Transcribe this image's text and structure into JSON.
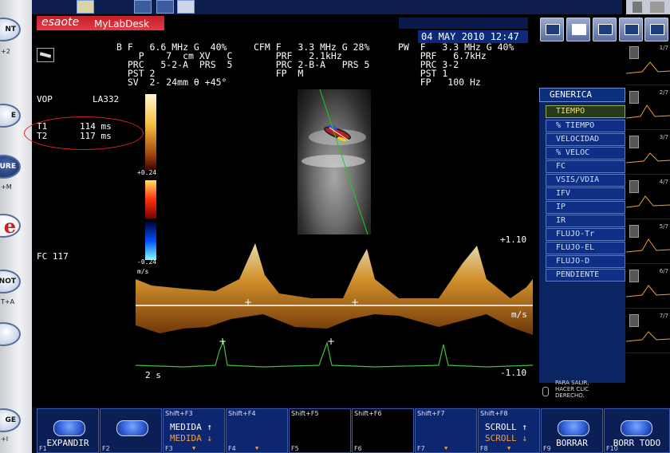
{
  "left_strip": {
    "buttons": [
      {
        "label": "NT",
        "sub": "+2"
      },
      {
        "label": "E",
        "sub": ""
      },
      {
        "label": "SURE",
        "sub": "+M"
      },
      {
        "label": "e",
        "sub": ""
      },
      {
        "label": "NOT",
        "sub": "T+A"
      },
      {
        "label": "",
        "sub": ""
      },
      {
        "label": "GE",
        "sub": "+I"
      }
    ]
  },
  "brand": {
    "logo": "esaote",
    "app": "MyLabDesk"
  },
  "datetime": "04 MAY 2010 12:47",
  "params": {
    "b_col": [
      "B F   6.6 MHz G  40%",
      "    P    7  cm XV   C",
      "  PRC   5-2-A  PRS  5",
      "  PST 2",
      "  SV  2- 24mm θ +45°"
    ],
    "cfm_col": [
      "CFM F   3.3 MHz G 28%",
      "    PRF   2.1kHz",
      "    PRC 2-B-A   PRS 5",
      "    FP  M"
    ],
    "pw_col": [
      "PW  F   3.3 MHz G 40%",
      "    PRF   6.7kHz",
      "    PRC 3-2",
      "    PST 1",
      "    FP   100 Hz"
    ]
  },
  "measurements": {
    "vop": "VOP",
    "probe": "LA332",
    "t1_label": "T1",
    "t1_value": "114 ms",
    "t2_label": "T2",
    "t2_value": "117 ms",
    "fc": "FC 117"
  },
  "colorbar": {
    "top": "+0.24",
    "bottom": "-0.24",
    "unit": "m/s"
  },
  "doppler": {
    "scale_top": "+1.10",
    "scale_bottom": "-1.10",
    "unit": "m/s",
    "time": "2 s"
  },
  "menu": {
    "header": "GENERICA",
    "items": [
      "TIEMPO",
      "% TIEMPO",
      "VELOCIDAD",
      "% VELOC",
      "FC",
      "VSIS/VDIA",
      "IFV",
      "IP",
      "IR",
      "FLUJO-Tr",
      "FLUJO-EL",
      "FLUJO-D",
      "PENDIENTE"
    ],
    "active": "TIEMPO",
    "exit_note": "PARA SALIR,\nHACER CLIC\nDERECHO."
  },
  "thumbs": [
    "1/7",
    "2/7",
    "3/7",
    "4/7",
    "5/7",
    "6/7",
    "7/7"
  ],
  "fkeys": [
    {
      "fnum": "F1",
      "label": "EXPANDIR"
    },
    {
      "fnum": "F2",
      "label": ""
    },
    {
      "fnum": "F3",
      "shift": "Shift+F3",
      "line1": "MEDIDA ↑",
      "line2": "MEDIDA ↓"
    },
    {
      "fnum": "F4",
      "shift": "Shift+F4",
      "line1": "",
      "line2": ""
    },
    {
      "fnum": "F5",
      "shift": "Shift+F5",
      "line1": "",
      "line2": ""
    },
    {
      "fnum": "F6",
      "shift": "Shift+F6",
      "line1": "",
      "line2": ""
    },
    {
      "fnum": "F7",
      "shift": "Shift+F7",
      "line1": "",
      "line2": ""
    },
    {
      "fnum": "F8",
      "shift": "Shift+F8",
      "line1": "SCROLL ↑",
      "line2": "SCROLL ↓"
    },
    {
      "fnum": "F9",
      "label": "BORRAR"
    },
    {
      "fnum": "F10",
      "label": "BORR TODO"
    }
  ],
  "colors": {
    "menu_bg": "#0b2462",
    "active_item": "#f5e35a",
    "brand_red": "#d42a33",
    "ecg": "#3cbf3c",
    "doppler": "#e8a030"
  }
}
